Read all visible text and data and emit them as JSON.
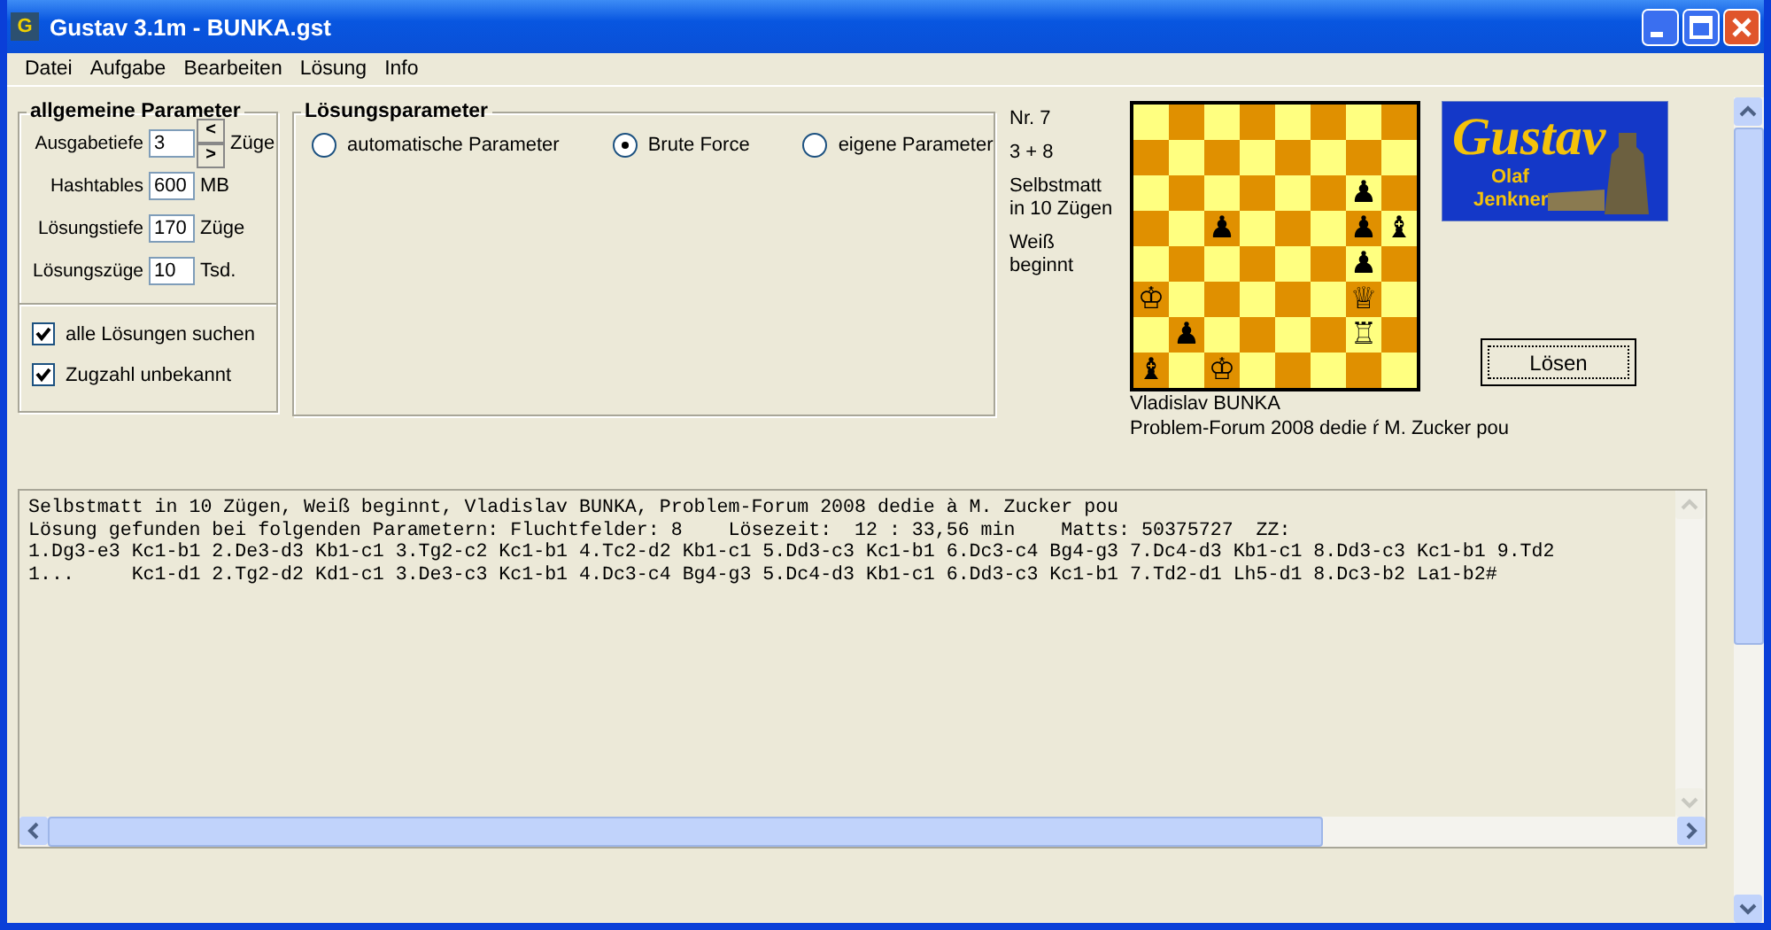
{
  "window": {
    "title": "Gustav 3.1m - BUNKA.gst",
    "app_icon": "G"
  },
  "menu": [
    {
      "label": "Datei"
    },
    {
      "label": "Aufgabe"
    },
    {
      "label": "Bearbeiten"
    },
    {
      "label": "Lösung"
    },
    {
      "label": "Info"
    }
  ],
  "general_params": {
    "title": "allgemeine Parameter",
    "fields": [
      {
        "label": "Ausgabetiefe",
        "value": "3",
        "unit": "Züge",
        "kind": "spin"
      },
      {
        "label": "Hashtables",
        "value": "600",
        "unit": "MB",
        "kind": "plain"
      },
      {
        "label": "Lösungstiefe",
        "value": "170",
        "unit": "Züge",
        "kind": "plain"
      },
      {
        "label": "Lösungszüge",
        "value": "10",
        "unit": "Tsd.",
        "kind": "plain"
      }
    ],
    "spin_buttons": [
      "<",
      ">"
    ],
    "checkboxes": [
      {
        "label": "alle Lösungen suchen",
        "checked": true
      },
      {
        "label": "Zugzahl unbekannt",
        "checked": true
      }
    ]
  },
  "solution_params": {
    "title": "Lösungsparameter",
    "options": [
      {
        "label": "automatische Parameter",
        "selected": false
      },
      {
        "label": "Brute Force",
        "selected": true
      },
      {
        "label": "eigene Parameter",
        "selected": false
      }
    ]
  },
  "problem_info": [
    {
      "text": "Nr. 7"
    },
    {
      "text": "3 + 8"
    },
    {
      "text": "Selbstmatt in 10 Zügen"
    },
    {
      "text": "Weiß beginnt"
    }
  ],
  "board": {
    "ranks": [
      [
        {
          "dark": false
        },
        {
          "dark": true
        },
        {
          "dark": false
        },
        {
          "dark": true
        },
        {
          "dark": false
        },
        {
          "dark": true
        },
        {
          "dark": false
        },
        {
          "dark": true
        }
      ],
      [
        {
          "dark": true
        },
        {
          "dark": false
        },
        {
          "dark": true
        },
        {
          "dark": false
        },
        {
          "dark": true
        },
        {
          "dark": false
        },
        {
          "dark": true
        },
        {
          "dark": false
        }
      ],
      [
        {
          "dark": false
        },
        {
          "dark": true
        },
        {
          "dark": false
        },
        {
          "dark": true
        },
        {
          "dark": false
        },
        {
          "dark": true
        },
        {
          "dark": false,
          "piece": "♟"
        },
        {
          "dark": true
        }
      ],
      [
        {
          "dark": true
        },
        {
          "dark": false
        },
        {
          "dark": true,
          "piece": "♟"
        },
        {
          "dark": false
        },
        {
          "dark": true
        },
        {
          "dark": false
        },
        {
          "dark": true,
          "piece": "♟"
        },
        {
          "dark": false,
          "piece": "♝"
        }
      ],
      [
        {
          "dark": false
        },
        {
          "dark": true
        },
        {
          "dark": false
        },
        {
          "dark": true
        },
        {
          "dark": false
        },
        {
          "dark": true
        },
        {
          "dark": false,
          "piece": "♟"
        },
        {
          "dark": true
        }
      ],
      [
        {
          "dark": true,
          "piece": "♔"
        },
        {
          "dark": false
        },
        {
          "dark": true
        },
        {
          "dark": false
        },
        {
          "dark": true
        },
        {
          "dark": false
        },
        {
          "dark": true,
          "piece": "♕"
        },
        {
          "dark": false
        }
      ],
      [
        {
          "dark": false
        },
        {
          "dark": true,
          "piece": "♟"
        },
        {
          "dark": false
        },
        {
          "dark": true
        },
        {
          "dark": false
        },
        {
          "dark": true
        },
        {
          "dark": false,
          "piece": "♖"
        },
        {
          "dark": true
        }
      ],
      [
        {
          "dark": true,
          "piece": "♝"
        },
        {
          "dark": false
        },
        {
          "dark": true,
          "piece": "♔"
        },
        {
          "dark": false
        },
        {
          "dark": true
        },
        {
          "dark": false
        },
        {
          "dark": true
        },
        {
          "dark": false
        }
      ]
    ],
    "caption": [
      "Vladislav BUNKA",
      "Problem-Forum 2008 dedie ŕ M. Zucker pou"
    ]
  },
  "logo": {
    "title": "Gustav",
    "subtitle": [
      "Olaf",
      "Jenkner"
    ]
  },
  "solve_button": "Lösen",
  "output": [
    "Selbstmatt in 10 Zügen, Weiß beginnt, Vladislav BUNKA, Problem-Forum 2008 dedie à M. Zucker pou",
    "Lösung gefunden bei folgenden Parametern: Fluchtfelder: 8    Lösezeit:  12 : 33,56 min    Matts: 50375727  ZZ:",
    "1.Dg3-e3 Kc1-b1 2.De3-d3 Kb1-c1 3.Tg2-c2 Kc1-b1 4.Tc2-d2 Kb1-c1 5.Dd3-c3 Kc1-b1 6.Dc3-c4 Bg4-g3 7.Dc4-d3 Kb1-c1 8.Dd3-c3 Kc1-b1 9.Td2",
    "1...     Kc1-d1 2.Tg2-d2 Kd1-c1 3.De3-c3 Kc1-b1 4.Dc3-c4 Bg4-g3 5.Dc4-d3 Kb1-c1 6.Dd3-c3 Kc1-b1 7.Td2-d1 Lh5-d1 8.Dc3-b2 La1-b2#"
  ]
}
